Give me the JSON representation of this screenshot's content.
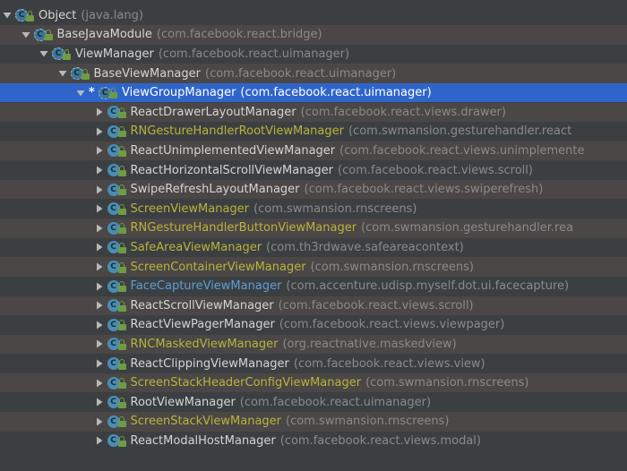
{
  "tree": {
    "rows": [
      {
        "name": "Object",
        "pkg": "(java.lang)",
        "depth": 0,
        "expanded": true,
        "abstract": true,
        "tone": "normal"
      },
      {
        "name": "BaseJavaModule",
        "pkg": "(com.facebook.react.bridge)",
        "depth": 1,
        "expanded": true,
        "abstract": true,
        "tone": "normal"
      },
      {
        "name": "ViewManager",
        "pkg": "(com.facebook.react.uimanager)",
        "depth": 2,
        "expanded": true,
        "abstract": true,
        "tone": "normal"
      },
      {
        "name": "BaseViewManager",
        "pkg": "(com.facebook.react.uimanager)",
        "depth": 3,
        "expanded": true,
        "abstract": true,
        "tone": "normal"
      },
      {
        "name": "ViewGroupManager",
        "pkg": "(com.facebook.react.uimanager)",
        "depth": 4,
        "expanded": true,
        "abstract": true,
        "tone": "normal",
        "selected": true,
        "marker": "*"
      },
      {
        "name": "ReactDrawerLayoutManager",
        "pkg": "(com.facebook.react.views.drawer)",
        "depth": 5,
        "expanded": false,
        "tone": "normal"
      },
      {
        "name": "RNGestureHandlerRootViewManager",
        "pkg": "(com.swmansion.gesturehandler.react",
        "depth": 5,
        "expanded": false,
        "tone": "yellow"
      },
      {
        "name": "ReactUnimplementedViewManager",
        "pkg": "(com.facebook.react.views.unimplemente",
        "depth": 5,
        "expanded": false,
        "tone": "normal"
      },
      {
        "name": "ReactHorizontalScrollViewManager",
        "pkg": "(com.facebook.react.views.scroll)",
        "depth": 5,
        "expanded": false,
        "tone": "normal"
      },
      {
        "name": "SwipeRefreshLayoutManager",
        "pkg": "(com.facebook.react.views.swiperefresh)",
        "depth": 5,
        "expanded": false,
        "tone": "normal"
      },
      {
        "name": "ScreenViewManager",
        "pkg": "(com.swmansion.rnscreens)",
        "depth": 5,
        "expanded": false,
        "tone": "yellow"
      },
      {
        "name": "RNGestureHandlerButtonViewManager",
        "pkg": "(com.swmansion.gesturehandler.rea",
        "depth": 5,
        "expanded": false,
        "tone": "yellow"
      },
      {
        "name": "SafeAreaViewManager",
        "pkg": "(com.th3rdwave.safeareacontext)",
        "depth": 5,
        "expanded": false,
        "tone": "yellow"
      },
      {
        "name": "ScreenContainerViewManager",
        "pkg": "(com.swmansion.rnscreens)",
        "depth": 5,
        "expanded": false,
        "tone": "yellow"
      },
      {
        "name": "FaceCaptureViewManager",
        "pkg": "(com.accenture.udisp.myself.dot.ui.facecapture)",
        "depth": 5,
        "expanded": false,
        "tone": "blue"
      },
      {
        "name": "ReactScrollViewManager",
        "pkg": "(com.facebook.react.views.scroll)",
        "depth": 5,
        "expanded": false,
        "tone": "normal"
      },
      {
        "name": "ReactViewPagerManager",
        "pkg": "(com.facebook.react.views.viewpager)",
        "depth": 5,
        "expanded": false,
        "tone": "normal"
      },
      {
        "name": "RNCMaskedViewManager",
        "pkg": "(org.reactnative.maskedview)",
        "depth": 5,
        "expanded": false,
        "tone": "yellow"
      },
      {
        "name": "ReactClippingViewManager",
        "pkg": "(com.facebook.react.views.view)",
        "depth": 5,
        "expanded": false,
        "tone": "normal"
      },
      {
        "name": "ScreenStackHeaderConfigViewManager",
        "pkg": "(com.swmansion.rnscreens)",
        "depth": 5,
        "expanded": false,
        "tone": "yellow"
      },
      {
        "name": "RootViewManager",
        "pkg": "(com.facebook.react.uimanager)",
        "depth": 5,
        "expanded": false,
        "tone": "normal"
      },
      {
        "name": "ScreenStackViewManager",
        "pkg": "(com.swmansion.rnscreens)",
        "depth": 5,
        "expanded": false,
        "tone": "yellow"
      },
      {
        "name": "ReactModalHostManager",
        "pkg": "(com.facebook.react.views.modal)",
        "depth": 5,
        "expanded": false,
        "tone": "normal"
      }
    ]
  },
  "icons": {
    "class_icon": "class-icon",
    "abstract_class_icon": "abstract-class-icon",
    "access_icon": "lock-icon",
    "expanded_icon": "triangle-down-icon",
    "collapsed_icon": "triangle-right-icon"
  },
  "colors": {
    "background": "#3c3f41",
    "row_alt": "#4a4746",
    "selection": "#2f65ca",
    "text": "#d4d4d4",
    "package_text": "#8a8a8a",
    "library_class": "#b9b33c",
    "project_class": "#5c9ed8"
  }
}
